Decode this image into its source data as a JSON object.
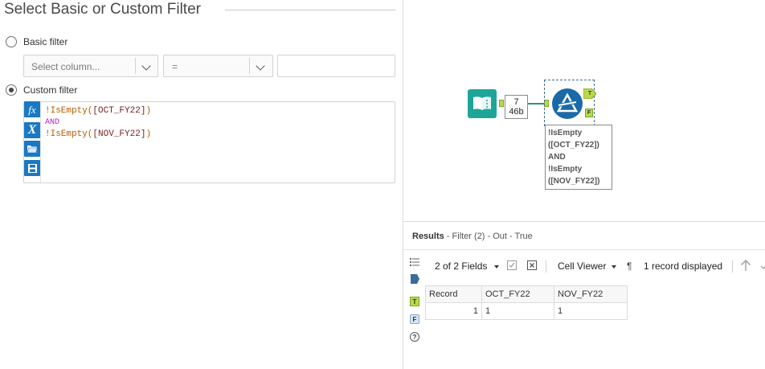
{
  "config": {
    "title": "Select Basic or Custom Filter",
    "basic_filter_label": "Basic filter",
    "select_column_placeholder": "Select column...",
    "operator_value": "=",
    "custom_filter_label": "Custom filter",
    "expression": {
      "line1_fn": "!IsEmpty(",
      "line1_arg": "[OCT_FY22]",
      "line1_end": ")",
      "line2": "AND",
      "line3_fn": "!IsEmpty(",
      "line3_arg": "[NOV_FY22]",
      "line3_end": ")"
    },
    "editor_buttons": [
      {
        "icon": "function-icon"
      },
      {
        "icon": "variable-icon"
      },
      {
        "icon": "open-folder-icon"
      },
      {
        "icon": "save-icon"
      }
    ]
  },
  "canvas": {
    "record_count": "7",
    "record_size": "46b",
    "annotation": "!IsEmpty\n([OCT_FY22])\nAND\n!IsEmpty\n([NOV_FY22])",
    "true_anchor": "T",
    "false_anchor": "F",
    "connection_color": "#3b8f7a",
    "filter_tool_color": "#1a6aa8",
    "input_tool_color": "#1ea59a"
  },
  "results": {
    "header_bold": "Results",
    "header_rest": " - Filter (2) - Out - True",
    "fields_label": "2 of 2 Fields",
    "cell_viewer_label": "Cell Viewer",
    "records_label": "1 record displayed",
    "columns": [
      "Record",
      "OCT_FY22",
      "NOV_FY22"
    ],
    "rows": [
      {
        "record": "1",
        "oct": "1",
        "nov": "1"
      }
    ],
    "side_anchor_t": "T",
    "side_anchor_f": "F"
  }
}
